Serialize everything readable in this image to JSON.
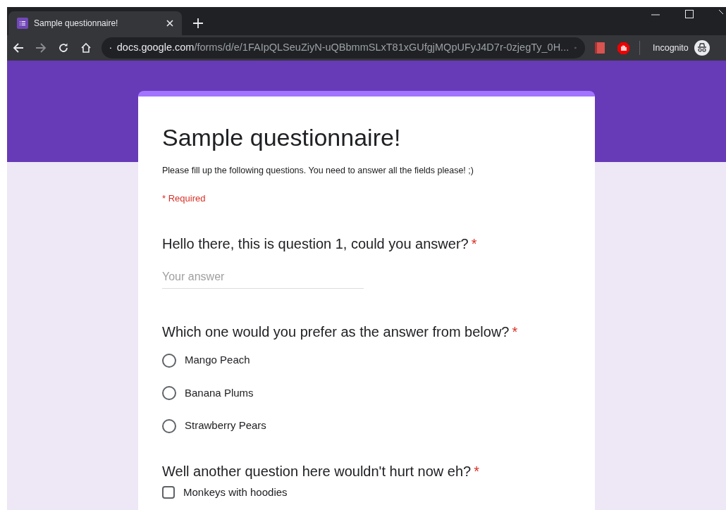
{
  "browser": {
    "tab": {
      "title": "Sample questionnaire!"
    },
    "url": {
      "domain": "docs.google.com",
      "path": "/forms/d/e/1FAIpQLSeuZiyN-uQBbmmSLxT81xGUfgjMQpUFyJ4D7r-0zjegTy_0H..."
    },
    "profile": "Incognito"
  },
  "form": {
    "title": "Sample questionnaire!",
    "description": "Please fill up the following questions. You need to answer all the fields please! ;)",
    "required_note": "* Required",
    "questions": [
      {
        "kind": "text",
        "title": "Hello there, this is question 1, could you answer?",
        "required_mark": "*",
        "placeholder": "Your answer"
      },
      {
        "kind": "radio",
        "title": "Which one would you prefer as the answer from below?",
        "required_mark": "*",
        "options": [
          {
            "label": "Mango Peach",
            "selected": false
          },
          {
            "label": "Banana Plums",
            "selected": false
          },
          {
            "label": "Strawberry Pears",
            "selected": false
          }
        ]
      },
      {
        "kind": "checkbox",
        "title": "Well another question here wouldn't hurt now eh?",
        "required_mark": "*",
        "options": [
          {
            "label": "Monkeys with hoodies",
            "checked": false
          }
        ]
      }
    ]
  }
}
